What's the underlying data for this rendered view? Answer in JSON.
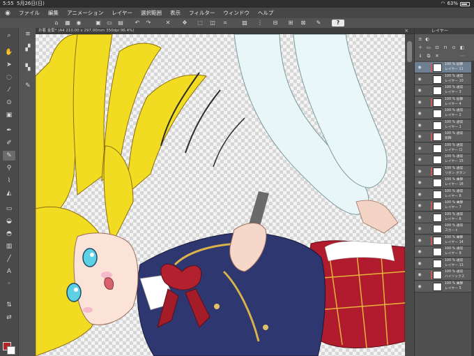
{
  "status_bar": {
    "time": "5:55",
    "date": "5月26日(日)",
    "battery": "63%",
    "battery_level": 0.63
  },
  "menu": {
    "items": [
      "ファイル",
      "編集",
      "アニメーション",
      "レイヤー",
      "選択範囲",
      "表示",
      "フィルター",
      "ウィンドウ",
      "ヘルプ"
    ]
  },
  "command_bar": {
    "help_label": "?"
  },
  "document": {
    "tab_title": "お着 金髪* (A4 210.00 x 297.00mm 350dpi 96.4%)",
    "close": "×"
  },
  "layer_panel": {
    "tab_label": "レイヤー",
    "layers": [
      {
        "mode": "100 % 加算",
        "name": "レイヤー 11"
      },
      {
        "mode": "100 % 通常",
        "name": "レイヤー 10"
      },
      {
        "mode": "100 % 通常",
        "name": "レイヤー 3"
      },
      {
        "mode": "100 % 加算",
        "name": "レイヤー 4"
      },
      {
        "mode": "100 % 通常",
        "name": "レイヤー 2"
      },
      {
        "mode": "100 % 通常",
        "name": "レイヤー 1"
      },
      {
        "mode": "100 % 通常",
        "name": "装飾"
      },
      {
        "mode": "100 % 通常",
        "name": "レイヤー 口"
      },
      {
        "mode": "100 % 通常",
        "name": "レイヤー 15"
      },
      {
        "mode": "100 % 通常",
        "name": "リボン ボタン"
      },
      {
        "mode": "100 % 乗算",
        "name": "レイヤー 16"
      },
      {
        "mode": "100 % 通常",
        "name": "レイヤー 8"
      },
      {
        "mode": "100 % 乗算",
        "name": "レイヤー 7"
      },
      {
        "mode": "100 % 通常",
        "name": "レイヤー 6"
      },
      {
        "mode": "100 % 通常",
        "name": "スカート"
      },
      {
        "mode": "100 % 乗算",
        "name": "レイヤー 14"
      },
      {
        "mode": "100 % 通常",
        "name": "レイヤー 9"
      },
      {
        "mode": "100 % 通常",
        "name": "レイヤー 13"
      },
      {
        "mode": "100 % 通常",
        "name": "ハイソックス"
      },
      {
        "mode": "100 % 乗算",
        "name": "レイヤー 5"
      }
    ]
  },
  "colors": {
    "main": "#b4252a",
    "sub": "#ffffff",
    "accent": "#6e7f92"
  }
}
